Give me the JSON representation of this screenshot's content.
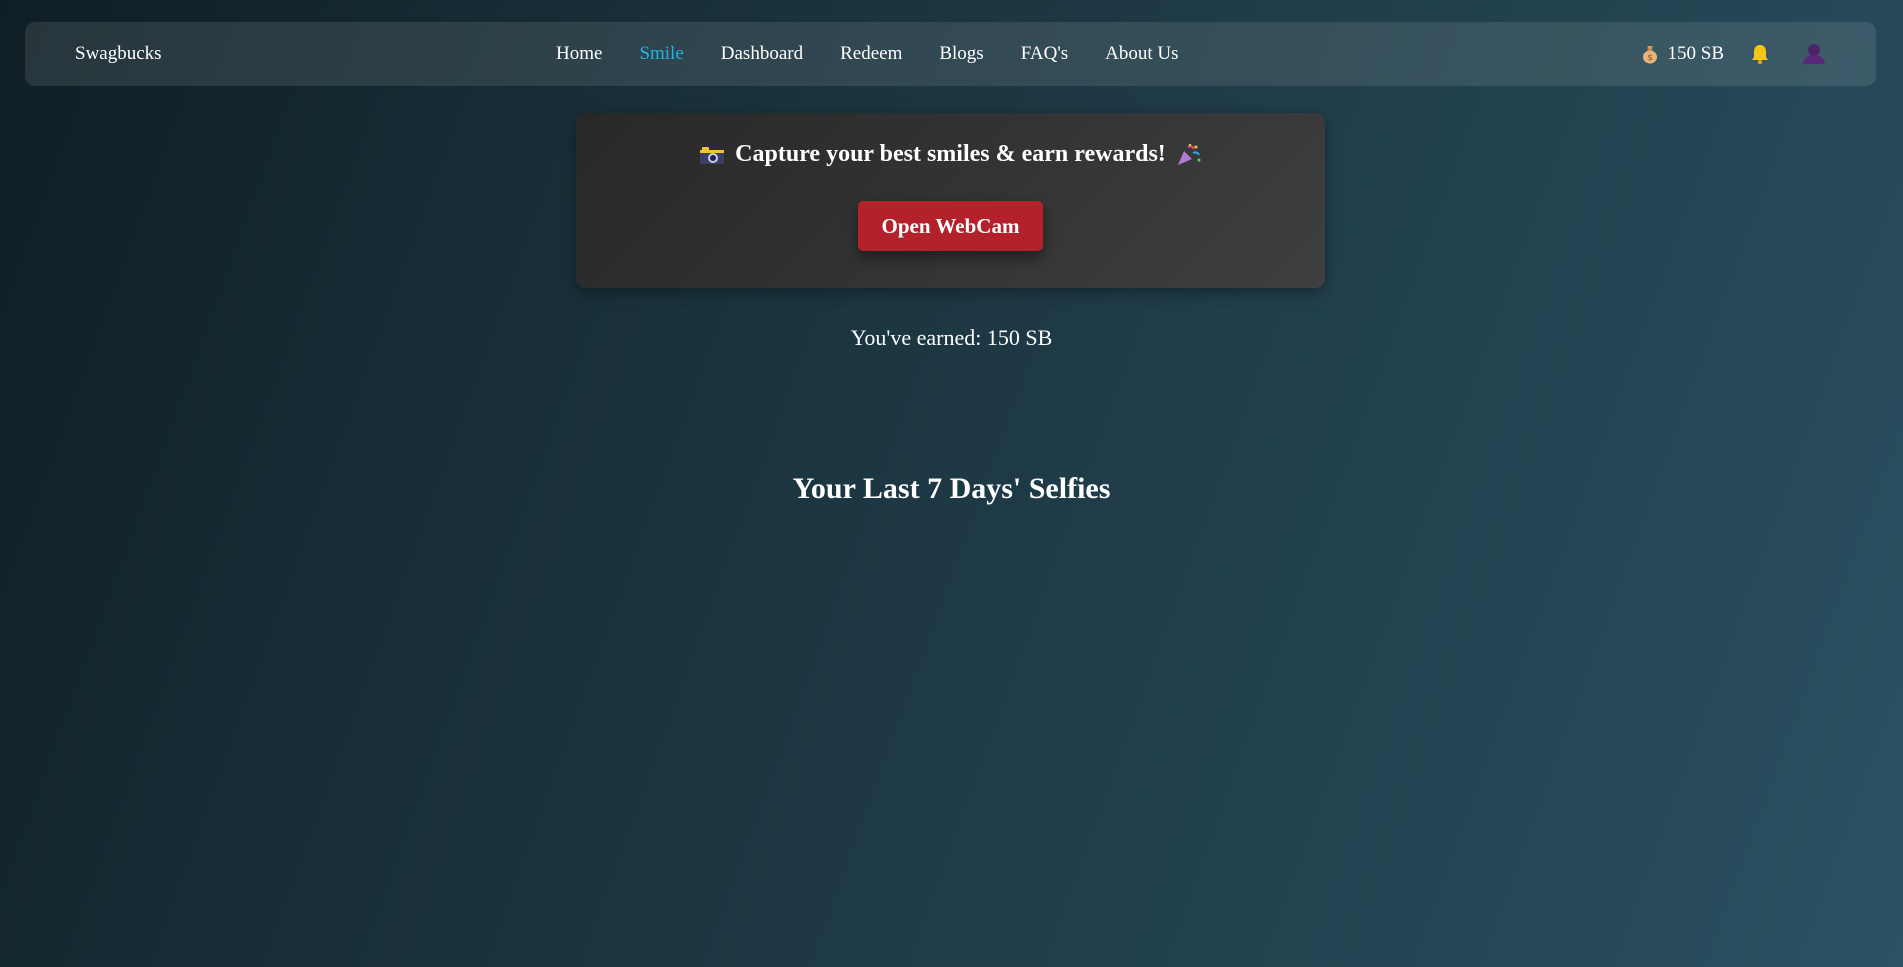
{
  "navbar": {
    "brand": "Swagbucks",
    "links": [
      {
        "label": "Home",
        "active": false
      },
      {
        "label": "Smile",
        "active": true
      },
      {
        "label": "Dashboard",
        "active": false
      },
      {
        "label": "Redeem",
        "active": false
      },
      {
        "label": "Blogs",
        "active": false
      },
      {
        "label": "FAQ's",
        "active": false
      },
      {
        "label": "About Us",
        "active": false
      }
    ],
    "balance": "150 SB",
    "icons": {
      "balance": "money-bag-icon",
      "notifications": "bell-icon",
      "profile": "user-avatar-icon"
    }
  },
  "capture_card": {
    "heading": "Capture your best smiles & earn rewards!",
    "leading_icon": "camera-icon",
    "trailing_icon": "party-popper-icon",
    "button_label": "Open WebCam"
  },
  "earned": {
    "text": "You've earned: 150 SB"
  },
  "selfies": {
    "heading": "Your Last 7 Days' Selfies"
  },
  "colors": {
    "active_link": "#1fb5e6",
    "button": "#b3222a",
    "bell": "#f5c518",
    "avatar": "#5a2a7a"
  }
}
